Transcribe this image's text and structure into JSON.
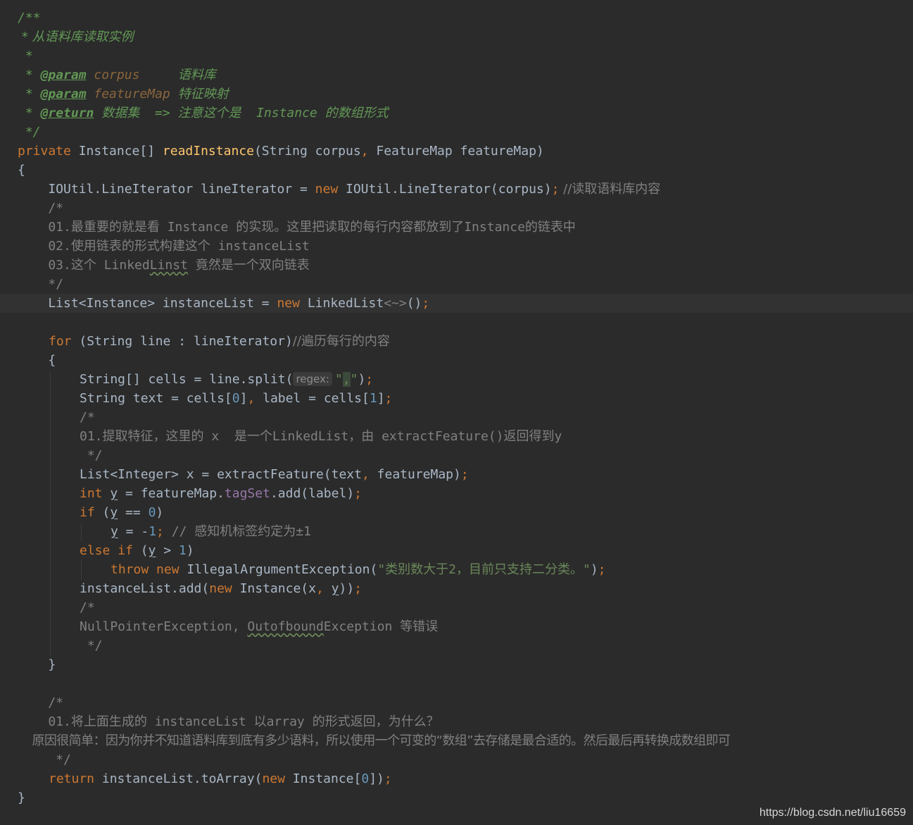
{
  "watermark": "https://blog.csdn.net/liu16659",
  "code": {
    "l01": "/**",
    "l02": " * 从语料库读取实例",
    "l03": " *",
    "l04_star": " * ",
    "l04_tag": "@param",
    "l04_name": " corpus",
    "l04_desc": "     语料库",
    "l05_star": " * ",
    "l05_tag": "@param",
    "l05_name": " featureMap",
    "l05_desc": " 特征映射",
    "l06_star": " * ",
    "l06_tag": "@return",
    "l06_desc": " 数据集  => 注意这个是  Instance 的数组形式",
    "l07": " */",
    "l08_kw": "private",
    "l08_a": " Instance[] ",
    "l08_fn": "readInstance",
    "l08_b": "(String corpus",
    "l08_comma": ",",
    "l08_c": " FeatureMap featureMap)",
    "l09": "{",
    "l10_a": "    IOUtil.LineIterator lineIterator = ",
    "l10_kw": "new",
    "l10_b": " IOUtil.LineIterator(corpus)",
    "l10_semi": ";",
    "l10_cm": " //读取语料库内容",
    "l11": "    /*",
    "l12": "    01.最重要的就是看 Instance 的实现。这里把读取的每行内容都放到了Instance的链表中",
    "l13": "    02.使用链表的形式构建这个 instanceList",
    "l14_a": "    03.这个 Linked",
    "l14_typo": "Linst",
    "l14_b": " 竟然是一个双向链表",
    "l15": "    */",
    "l16_a": "    List<Instance> instanceList = ",
    "l16_kw": "new",
    "l16_b": " LinkedList",
    "l16_gen": "<~>",
    "l16_c": "()",
    "l16_semi": ";",
    "l18_kw": "for",
    "l18_a": " (String line : lineIterator)",
    "l18_cm": "//遍历每行的内容",
    "l19": "    {",
    "l20_a": "String[] cells = line.split(",
    "l20_hint": "regex:",
    "l20_str1": "\"",
    "l20_strhl": ",",
    "l20_str2": "\"",
    "l20_b": ")",
    "l20_semi": ";",
    "l21_a": "String text = cells[",
    "l21_n0": "0",
    "l21_b": "]",
    "l21_comma": ",",
    "l21_c": " label = cells[",
    "l21_n1": "1",
    "l21_d": "]",
    "l21_semi": ";",
    "l22": "/*",
    "l23": "01.提取特征，这里的 x  是一个LinkedList，由 extractFeature()返回得到y",
    "l24": " */",
    "l25_a": "List<Integer> x = extractFeature(text",
    "l25_comma": ",",
    "l25_b": " featureMap)",
    "l25_semi": ";",
    "l26_kw": "int",
    "l26_sp": " ",
    "l26_y": "y",
    "l26_a": " = featureMap.",
    "l26_field": "tagSet",
    "l26_b": ".add(label)",
    "l26_semi": ";",
    "l27_kw": "if",
    "l27_a": " (",
    "l27_y": "y",
    "l27_b": " == ",
    "l27_n": "0",
    "l27_c": ")",
    "l28_y": "y",
    "l28_a": " = -",
    "l28_n": "1",
    "l28_semi": ";",
    "l28_cm": " // 感知机标签约定为±1",
    "l29_kw": "else if",
    "l29_a": " (",
    "l29_y": "y",
    "l29_b": " > ",
    "l29_n": "1",
    "l29_c": ")",
    "l30_kw1": "throw",
    "l30_sp": " ",
    "l30_kw2": "new",
    "l30_a": " IllegalArgumentException(",
    "l30_str": "\"类别数大于2，目前只支持二分类。\"",
    "l30_b": ")",
    "l30_semi": ";",
    "l31_a": "instanceList.add(",
    "l31_kw": "new",
    "l31_b": " Instance(x",
    "l31_comma": ",",
    "l31_sp": " ",
    "l31_y": "y",
    "l31_c": "))",
    "l31_semi": ";",
    "l32": "/*",
    "l33_a": "NullPointerException, ",
    "l33_typo": "Outofbound",
    "l33_b": "Exception 等错误",
    "l34": " */",
    "l35": "    }",
    "l37": "    /*",
    "l38": "    01.将上面生成的 instanceList 以array 的形式返回，为什么？",
    "l39": "    原因很简单：因为你并不知道语料库到底有多少语料，所以使用一个可变的“数组”去存储是最合适的。然后最后再转换成数组即可",
    "l40": "     */",
    "l41_kw": "return",
    "l41_a": " instanceList.toArray(",
    "l41_kw2": "new",
    "l41_b": " Instance[",
    "l41_n": "0",
    "l41_c": "])",
    "l41_semi": ";",
    "l42": "}"
  }
}
